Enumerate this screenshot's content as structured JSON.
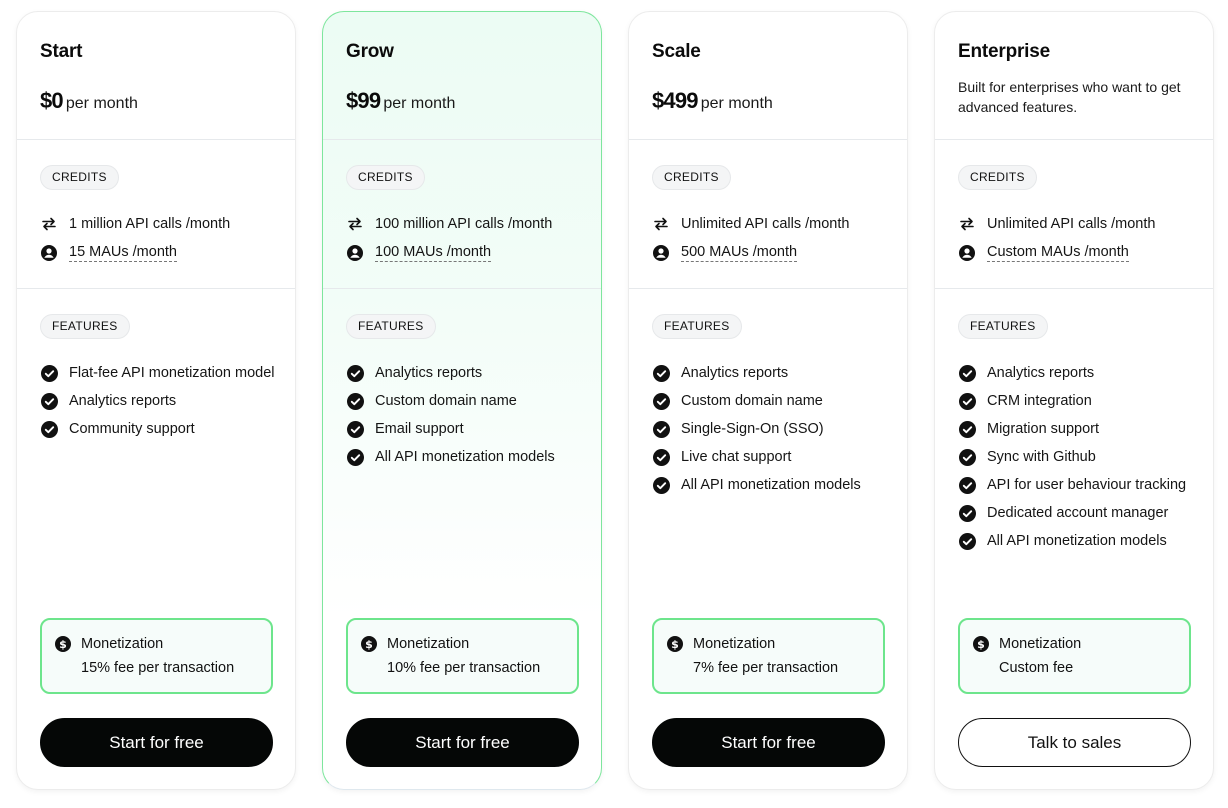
{
  "plans": [
    {
      "name": "Start",
      "price": "$0",
      "price_suffix": "per month",
      "credits_label": "CREDITS",
      "api_calls": "1 million API calls /month",
      "maus": "15 MAUs /month",
      "features_label": "FEATURES",
      "features": [
        "Flat-fee API monetization model",
        "Analytics reports",
        "Community support"
      ],
      "monetization_title": "Monetization",
      "monetization_fee": "15% fee per transaction",
      "cta": "Start for free"
    },
    {
      "name": "Grow",
      "price": "$99",
      "price_suffix": "per month",
      "credits_label": "CREDITS",
      "api_calls": "100 million API calls /month",
      "maus": "100 MAUs /month",
      "features_label": "FEATURES",
      "features": [
        "Analytics reports",
        "Custom domain name",
        "Email support",
        "All API monetization models"
      ],
      "monetization_title": "Monetization",
      "monetization_fee": "10% fee per transaction",
      "cta": "Start for free"
    },
    {
      "name": "Scale",
      "price": "$499",
      "price_suffix": "per month",
      "credits_label": "CREDITS",
      "api_calls": "Unlimited API calls /month",
      "maus": "500 MAUs /month",
      "features_label": "FEATURES",
      "features": [
        "Analytics reports",
        "Custom domain name",
        "Single-Sign-On (SSO)",
        "Live chat support",
        "All API monetization models"
      ],
      "monetization_title": "Monetization",
      "monetization_fee": "7% fee per transaction",
      "cta": "Start for free"
    },
    {
      "name": "Enterprise",
      "description": "Built for enterprises who want to get advanced features.",
      "credits_label": "CREDITS",
      "api_calls": "Unlimited API calls /month",
      "maus": "Custom MAUs /month",
      "features_label": "FEATURES",
      "features": [
        "Analytics reports",
        "CRM integration",
        "Migration support",
        "Sync with Github",
        "API for user behaviour tracking",
        "Dedicated account manager",
        "All API monetization models"
      ],
      "monetization_title": "Monetization",
      "monetization_fee": "Custom fee",
      "cta": "Talk to sales"
    }
  ],
  "icons": {
    "api_calls": "arrows-exchange-icon",
    "maus": "user-circle-icon",
    "feature": "check-circle-icon",
    "monetization": "dollar-circle-icon"
  },
  "colors": {
    "accent_green": "#6de58c",
    "highlight_bg": "#ecfcf4",
    "button_dark": "#050706"
  }
}
